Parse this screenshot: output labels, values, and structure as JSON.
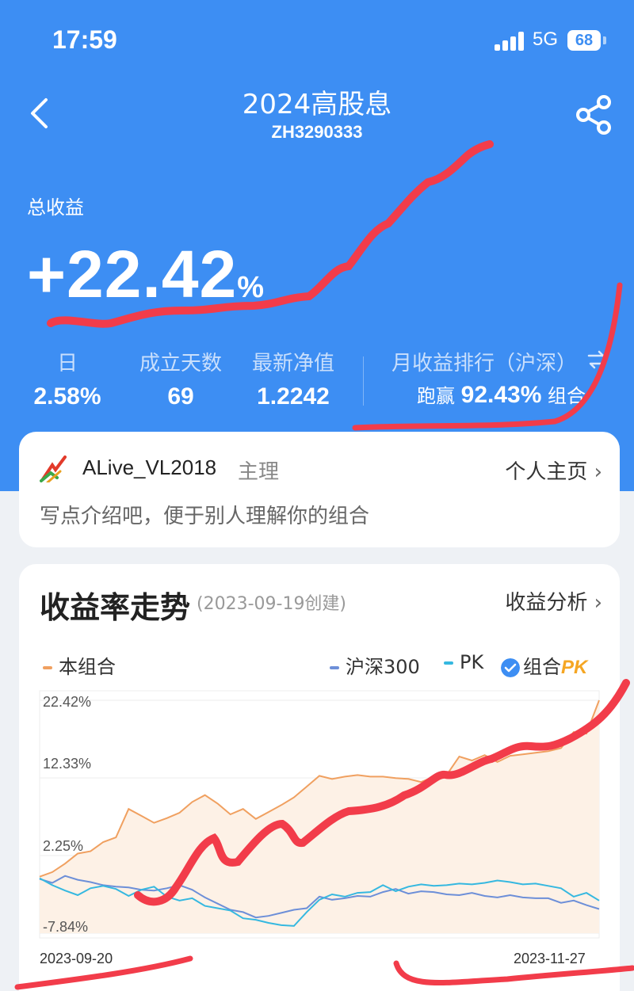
{
  "status_bar": {
    "time": "17:59",
    "network": "5G",
    "battery": "68"
  },
  "header": {
    "title": "2024高股息",
    "code": "ZH3290333"
  },
  "summary": {
    "total_label": "总收益",
    "total_value": "+22.42",
    "total_unit": "%"
  },
  "stats": [
    {
      "label": "日",
      "value": "2.58%"
    },
    {
      "label": "成立天数",
      "value": "69"
    },
    {
      "label": "最新净值",
      "value": "1.2242"
    }
  ],
  "rank": {
    "label": "月收益排行（沪深）",
    "prefix": "跑赢",
    "value": "92.43%",
    "suffix": "组合"
  },
  "manager": {
    "name": "ALive_VL2018",
    "role": "主理",
    "profile_link": "个人主页",
    "intro": "写点介绍吧，便于别人理解你的组合"
  },
  "chart_section": {
    "title": "收益率走势",
    "created": "(2023-09-19创建)",
    "analysis_link": "收益分析"
  },
  "legend": {
    "portfolio": "本组合",
    "index": "沪深300",
    "pk": "PK",
    "pk_toggle": "组合",
    "pk_badge": "PK"
  },
  "colors": {
    "brand": "#3d8ef3",
    "portfolio": "#f0a060",
    "index": "#6d8fd8",
    "pk": "#35b8e0",
    "scribble": "#f23c4a"
  },
  "chart_data": {
    "type": "line",
    "x_start": "2023-09-20",
    "x_end": "2023-11-27",
    "x_ticks": [
      "2023-09-20",
      "2023-11-27"
    ],
    "y_ticks": [
      "22.42%",
      "12.33%",
      "2.25%",
      "-7.84%"
    ],
    "ylim": [
      -7.84,
      22.42
    ],
    "series": [
      {
        "name": "本组合",
        "values": [
          -0.5,
          0.1,
          1.2,
          2.5,
          2.8,
          4.0,
          4.6,
          8.3,
          7.4,
          6.5,
          7.1,
          7.8,
          9.2,
          10.1,
          9.0,
          7.6,
          8.3,
          7.0,
          7.9,
          8.8,
          9.8,
          11.2,
          12.6,
          12.2,
          12.5,
          12.7,
          12.5,
          12.5,
          12.3,
          12.2,
          11.8,
          12.5,
          12.7,
          15.1,
          14.6,
          15.3,
          14.4,
          15.2,
          15.4,
          15.6,
          15.8,
          16.2,
          18.3,
          18.1,
          22.42
        ]
      },
      {
        "name": "沪深300",
        "values": [
          -0.8,
          -1.3,
          -0.4,
          -0.9,
          -1.2,
          -1.6,
          -1.8,
          -1.9,
          -2.2,
          -2.3,
          -2.0,
          -1.6,
          -2.2,
          -3.2,
          -4.0,
          -4.8,
          -5.1,
          -5.8,
          -5.6,
          -5.2,
          -4.8,
          -4.6,
          -3.1,
          -3.5,
          -3.3,
          -3.0,
          -3.1,
          -2.5,
          -2.1,
          -2.7,
          -2.4,
          -2.5,
          -2.8,
          -2.9,
          -2.6,
          -3.0,
          -3.2,
          -2.9,
          -3.2,
          -3.3,
          -3.3,
          -3.9,
          -3.6,
          -4.2,
          -4.7
        ]
      },
      {
        "name": "PK",
        "values": [
          -0.7,
          -1.6,
          -2.3,
          -2.9,
          -2.0,
          -1.7,
          -2.1,
          -3.0,
          -2.2,
          -1.8,
          -3.1,
          -3.6,
          -3.3,
          -4.3,
          -4.6,
          -4.9,
          -5.9,
          -6.1,
          -6.5,
          -6.8,
          -6.9,
          -5.1,
          -3.5,
          -2.8,
          -3.1,
          -2.6,
          -2.5,
          -1.6,
          -2.4,
          -1.8,
          -1.5,
          -1.7,
          -1.6,
          -1.4,
          -1.5,
          -1.3,
          -1.0,
          -1.2,
          -1.5,
          -1.4,
          -1.7,
          -2.0,
          -3.1,
          -2.6,
          -3.6
        ]
      }
    ]
  }
}
